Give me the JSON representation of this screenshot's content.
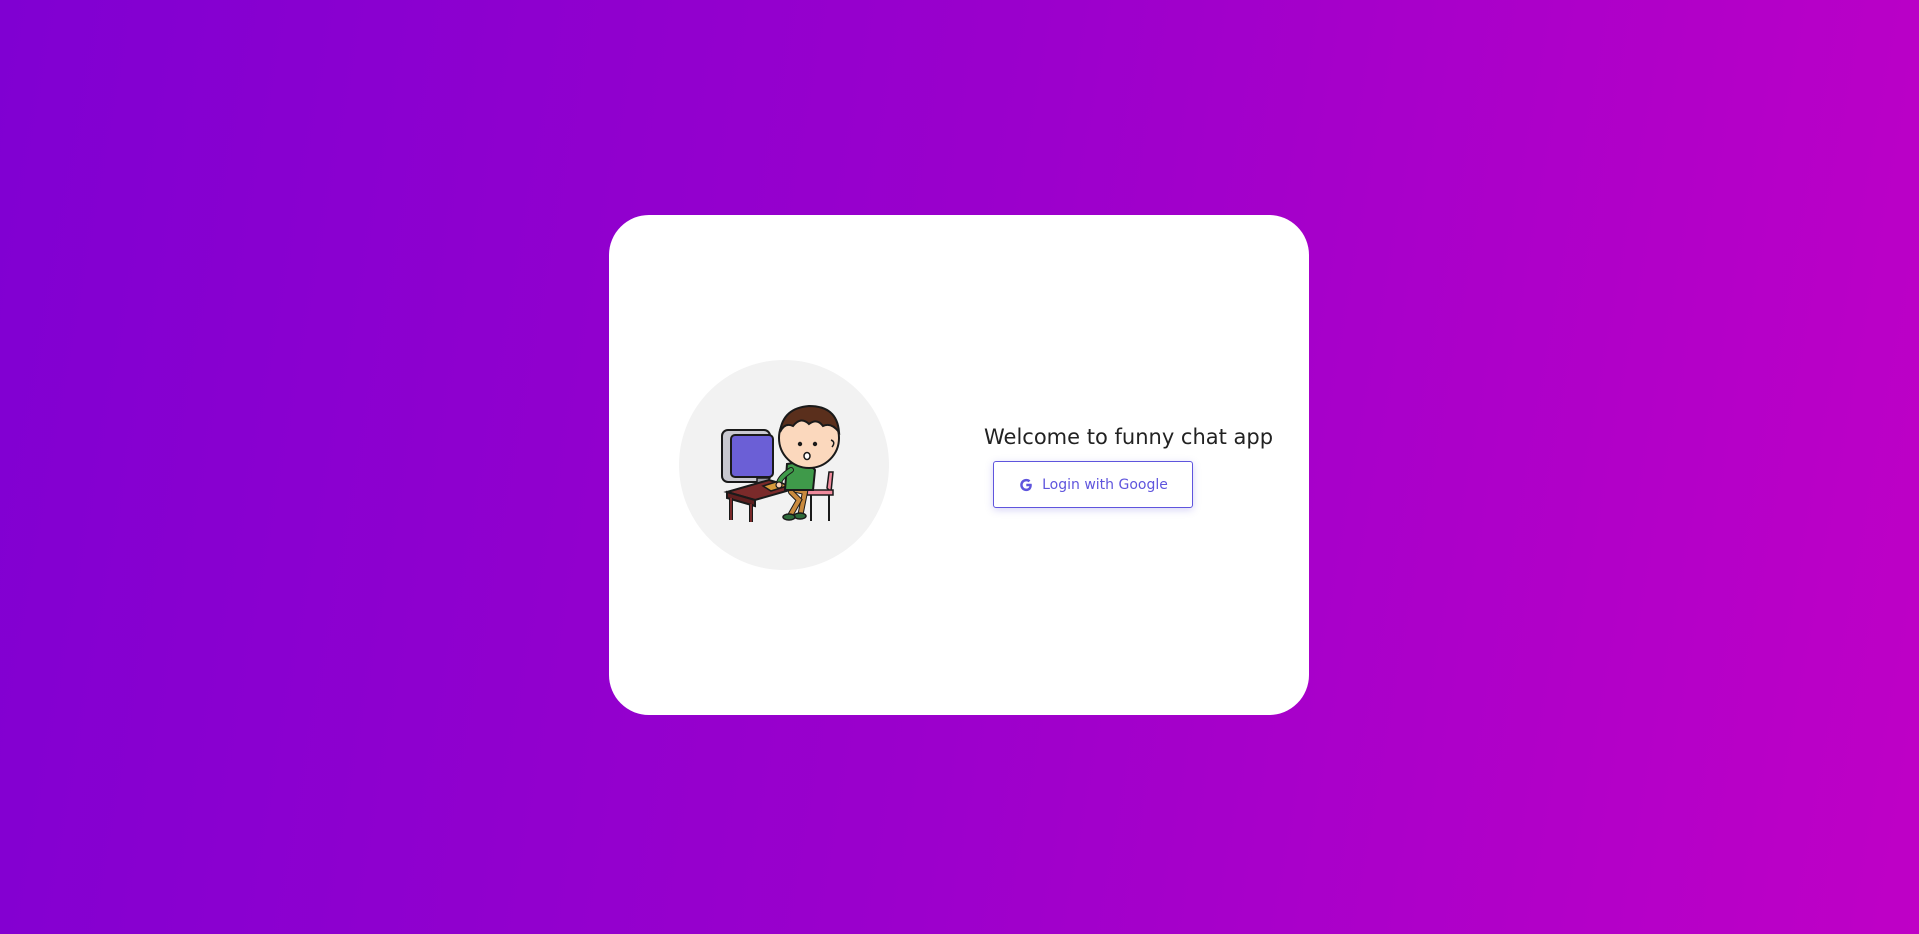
{
  "card": {
    "illustration_icon": "person-at-computer-illustration",
    "title": "Welcome to funny chat app",
    "login_button": {
      "label": "Login with Google",
      "icon": "google-icon"
    }
  },
  "colors": {
    "background_gradient_start": "#8000d2",
    "background_gradient_end": "#bf00c6",
    "card_background": "#ffffff",
    "accent": "#5f55dd",
    "title_text": "#222222",
    "illustration_circle": "#f2f2f2"
  }
}
